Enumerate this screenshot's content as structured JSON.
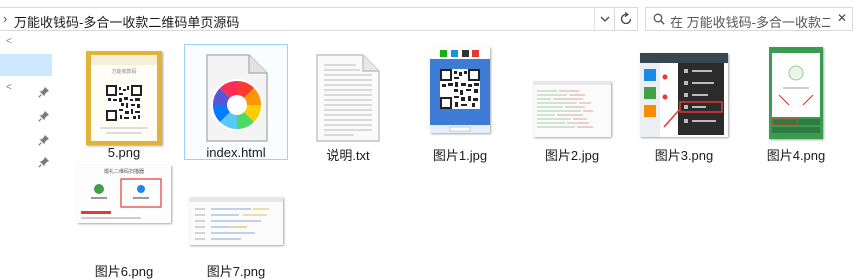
{
  "address_bar": {
    "path": "万能收钱码-多合一收款二维码单页源码",
    "refresh_icon": "refresh-icon",
    "dropdown_icon": "chevron-down-icon"
  },
  "search": {
    "placeholder": "在 万能收钱码-多合一收款二...",
    "search_icon": "search-icon",
    "clear_symbol": "✕"
  },
  "nav": {
    "pin_icon": "pin-icon",
    "chevron_icon": "chevron-left-icon"
  },
  "files": [
    {
      "name": "5.png",
      "type": "png"
    },
    {
      "name": "index.html",
      "type": "html"
    },
    {
      "name": "说明.txt",
      "type": "txt"
    },
    {
      "name": "图片1.jpg",
      "type": "jpg"
    },
    {
      "name": "图片2.jpg",
      "type": "jpg"
    },
    {
      "name": "图片3.png",
      "type": "png"
    },
    {
      "name": "图片4.png",
      "type": "png"
    },
    {
      "name": "图片6.png",
      "type": "png"
    },
    {
      "name": "图片7.png",
      "type": "png"
    }
  ],
  "thumbnails": {
    "file0": {
      "title_text": "万能收款码",
      "colors": {
        "frame": "#e0b43a",
        "qr": "#222222"
      }
    },
    "file3": {
      "colors": {
        "frame": "#3e7bd6",
        "qr": "#222222"
      }
    },
    "file5": {
      "colors": {
        "sidebar": "#37474f",
        "menu": "#2b2b2b",
        "highlight": "#e53935"
      }
    },
    "file6": {
      "colors": {
        "frame": "#3b9b50",
        "highlight": "#e53935"
      }
    },
    "file7": {
      "title_text": "婚礼二维码扫描器",
      "colors": {
        "highlight": "#e53935"
      }
    }
  },
  "colors": {
    "selection_fill": "#cde8ff",
    "selection_border": "#99d1ff"
  }
}
